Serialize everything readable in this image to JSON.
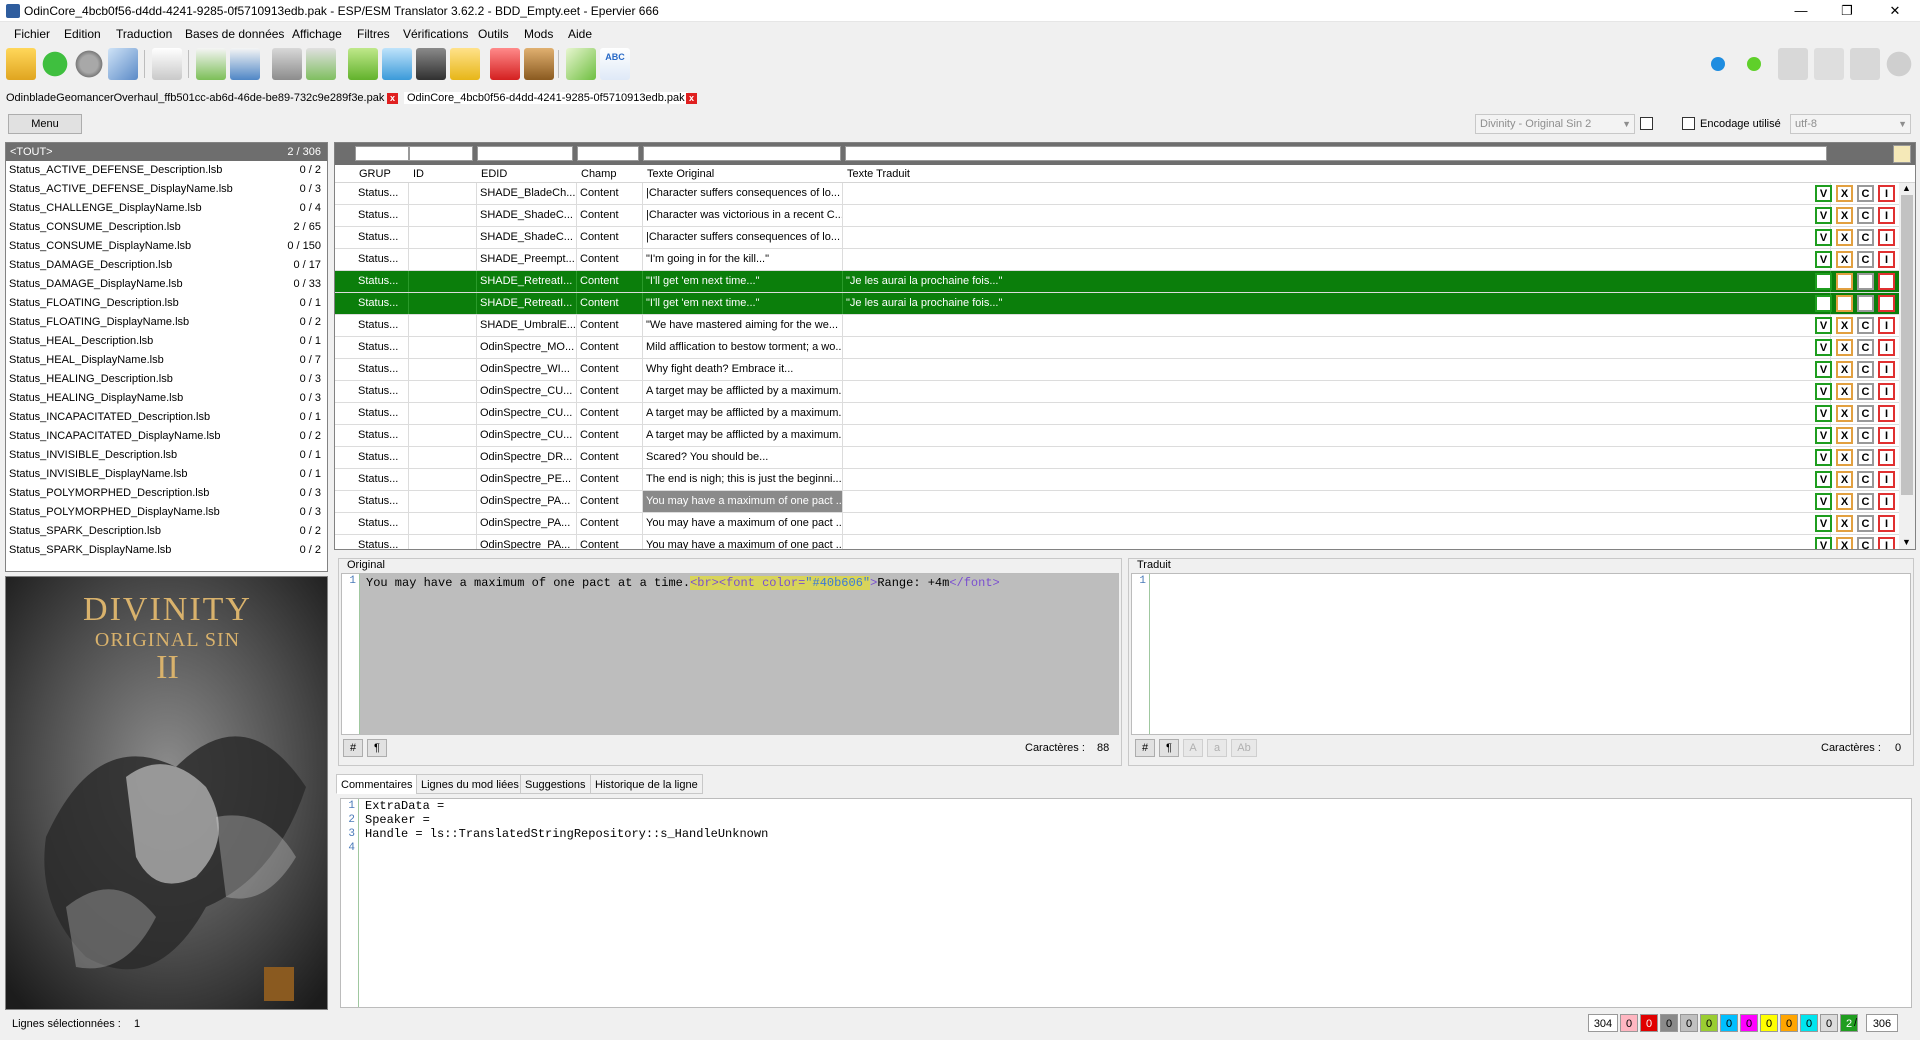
{
  "window": {
    "title": "OdinCore_4bcb0f56-d4dd-4241-9285-0f5710913edb.pak - ESP/ESM Translator 3.62.2 - BDD_Empty.eet - Epervier 666",
    "minimize": "—",
    "maximize": "❐",
    "close": "✕"
  },
  "menubar": [
    "Fichier",
    "Edition",
    "Traduction",
    "Bases de données",
    "Affichage",
    "Filtres",
    "Vérifications",
    "Outils",
    "Mods",
    "Aide"
  ],
  "file_tabs": [
    {
      "label": "OdinbladeGeomancerOverhaul_ffb501cc-ab6d-46de-be89-732c9e289f3e.pak",
      "close": "x"
    },
    {
      "label": "OdinCore_4bcb0f56-d4dd-4241-9285-0f5710913edb.pak",
      "close": "x"
    }
  ],
  "controls": {
    "menu_label": "Menu",
    "game_select": "Divinity - Original Sin 2",
    "encoding_label": "Encodage utilisé",
    "encoding_value": "utf-8"
  },
  "file_list": {
    "header_name": "<TOUT>",
    "header_count": "2 / 306",
    "items": [
      {
        "name": "Status_ACTIVE_DEFENSE_Description.lsb",
        "count": "0 / 2"
      },
      {
        "name": "Status_ACTIVE_DEFENSE_DisplayName.lsb",
        "count": "0 / 3"
      },
      {
        "name": "Status_CHALLENGE_DisplayName.lsb",
        "count": "0 / 4"
      },
      {
        "name": "Status_CONSUME_Description.lsb",
        "count": "2 / 65"
      },
      {
        "name": "Status_CONSUME_DisplayName.lsb",
        "count": "0 / 150"
      },
      {
        "name": "Status_DAMAGE_Description.lsb",
        "count": "0 / 17"
      },
      {
        "name": "Status_DAMAGE_DisplayName.lsb",
        "count": "0 / 33"
      },
      {
        "name": "Status_FLOATING_Description.lsb",
        "count": "0 / 1"
      },
      {
        "name": "Status_FLOATING_DisplayName.lsb",
        "count": "0 / 2"
      },
      {
        "name": "Status_HEAL_Description.lsb",
        "count": "0 / 1"
      },
      {
        "name": "Status_HEAL_DisplayName.lsb",
        "count": "0 / 7"
      },
      {
        "name": "Status_HEALING_Description.lsb",
        "count": "0 / 3"
      },
      {
        "name": "Status_HEALING_DisplayName.lsb",
        "count": "0 / 3"
      },
      {
        "name": "Status_INCAPACITATED_Description.lsb",
        "count": "0 / 1"
      },
      {
        "name": "Status_INCAPACITATED_DisplayName.lsb",
        "count": "0 / 2"
      },
      {
        "name": "Status_INVISIBLE_Description.lsb",
        "count": "0 / 1"
      },
      {
        "name": "Status_INVISIBLE_DisplayName.lsb",
        "count": "0 / 1"
      },
      {
        "name": "Status_POLYMORPHED_Description.lsb",
        "count": "0 / 3"
      },
      {
        "name": "Status_POLYMORPHED_DisplayName.lsb",
        "count": "0 / 3"
      },
      {
        "name": "Status_SPARK_Description.lsb",
        "count": "0 / 2"
      },
      {
        "name": "Status_SPARK_DisplayName.lsb",
        "count": "0 / 2"
      }
    ]
  },
  "cover": {
    "title_line1": "DIVINITY",
    "title_line2": "ORIGINAL SIN",
    "title_line3": "II"
  },
  "grid": {
    "columns": [
      "GRUP",
      "ID",
      "EDID",
      "Champ",
      "Texte Original",
      "Texte Traduit"
    ],
    "action_labels": [
      "V",
      "X",
      "C",
      "I"
    ],
    "rows": [
      {
        "grup": "Status...",
        "id": "",
        "edid": "SHADE_BladeCh...",
        "champ": "Content",
        "orig": "|Character suffers consequences of lo...",
        "trad": "",
        "sel": false,
        "hl": false
      },
      {
        "grup": "Status...",
        "id": "",
        "edid": "SHADE_ShadeC...",
        "champ": "Content",
        "orig": "|Character was victorious in a recent C...",
        "trad": "",
        "sel": false,
        "hl": false
      },
      {
        "grup": "Status...",
        "id": "",
        "edid": "SHADE_ShadeC...",
        "champ": "Content",
        "orig": "|Character suffers consequences of lo...",
        "trad": "",
        "sel": false,
        "hl": false
      },
      {
        "grup": "Status...",
        "id": "",
        "edid": "SHADE_Preempt...",
        "champ": "Content",
        "orig": "\"I'm going in for the kill...\"",
        "trad": "",
        "sel": false,
        "hl": false
      },
      {
        "grup": "Status...",
        "id": "",
        "edid": "SHADE_RetreatI...",
        "champ": "Content",
        "orig": "\"I'll get 'em next time...\"",
        "trad": "\"Je les aurai la prochaine fois...\"",
        "sel": true,
        "hl": false
      },
      {
        "grup": "Status...",
        "id": "",
        "edid": "SHADE_RetreatI...",
        "champ": "Content",
        "orig": "\"I'll get 'em next time...\"",
        "trad": "\"Je les aurai la prochaine fois...\"",
        "sel": true,
        "hl": false
      },
      {
        "grup": "Status...",
        "id": "",
        "edid": "SHADE_UmbralE...",
        "champ": "Content",
        "orig": "\"We have mastered aiming for the we...",
        "trad": "",
        "sel": false,
        "hl": false
      },
      {
        "grup": "Status...",
        "id": "",
        "edid": "OdinSpectre_MO...",
        "champ": "Content",
        "orig": "Mild afflication to bestow torment; a wo...",
        "trad": "",
        "sel": false,
        "hl": false
      },
      {
        "grup": "Status...",
        "id": "",
        "edid": "OdinSpectre_WI...",
        "champ": "Content",
        "orig": "Why fight death? Embrace it...",
        "trad": "",
        "sel": false,
        "hl": false
      },
      {
        "grup": "Status...",
        "id": "",
        "edid": "OdinSpectre_CU...",
        "champ": "Content",
        "orig": "A target may be afflicted by a maximum...",
        "trad": "",
        "sel": false,
        "hl": false
      },
      {
        "grup": "Status...",
        "id": "",
        "edid": "OdinSpectre_CU...",
        "champ": "Content",
        "orig": "A target may be afflicted by a maximum...",
        "trad": "",
        "sel": false,
        "hl": false
      },
      {
        "grup": "Status...",
        "id": "",
        "edid": "OdinSpectre_CU...",
        "champ": "Content",
        "orig": "A target may be afflicted by a maximum...",
        "trad": "",
        "sel": false,
        "hl": false
      },
      {
        "grup": "Status...",
        "id": "",
        "edid": "OdinSpectre_DR...",
        "champ": "Content",
        "orig": "Scared? You should be...",
        "trad": "",
        "sel": false,
        "hl": false
      },
      {
        "grup": "Status...",
        "id": "",
        "edid": "OdinSpectre_PE...",
        "champ": "Content",
        "orig": "The end is nigh; this is just the beginni...",
        "trad": "",
        "sel": false,
        "hl": false
      },
      {
        "grup": "Status...",
        "id": "",
        "edid": "OdinSpectre_PA...",
        "champ": "Content",
        "orig": "You may have a maximum of one pact ...",
        "trad": "",
        "sel": false,
        "hl": true
      },
      {
        "grup": "Status...",
        "id": "",
        "edid": "OdinSpectre_PA...",
        "champ": "Content",
        "orig": "You may have a maximum of one pact ...",
        "trad": "",
        "sel": false,
        "hl": false
      },
      {
        "grup": "Status...",
        "id": "",
        "edid": "OdinSpectre_PA...",
        "champ": "Content",
        "orig": "You may have a maximum of one pact ...",
        "trad": "",
        "sel": false,
        "hl": false
      }
    ]
  },
  "original_editor": {
    "label": "Original",
    "line_no": "1",
    "text_plain": "You may have a maximum of one pact at a time.",
    "tag_br": "<br>",
    "tag_font_open": "<font color=",
    "attr_value": "\"#40b606\"",
    "tag_close_bracket": ">",
    "text_range": "Range: +4m",
    "tag_font_close": "</font>",
    "chars_label": "Caractères :",
    "chars_value": "88",
    "btn_hash": "#",
    "btn_pilcrow": "¶"
  },
  "translated_editor": {
    "label": "Traduit",
    "line_no": "1",
    "chars_label": "Caractères :",
    "chars_value": "0",
    "btn_hash": "#",
    "btn_pilcrow": "¶",
    "btn_upper": "A",
    "btn_lower": "a",
    "btn_title": "Ab"
  },
  "bottom_tabs": [
    "Commentaires",
    "Lignes du mod liées",
    "Suggestions",
    "Historique de la ligne"
  ],
  "comments": {
    "line_numbers": [
      "1",
      "2",
      "3",
      "4"
    ],
    "lines": [
      "ExtraData =",
      "Speaker =",
      "Handle = ls::TranslatedStringRepository::s_HandleUnknown",
      ""
    ]
  },
  "status": {
    "selected_label": "Lignes sélectionnées :",
    "selected_value": "1",
    "counters": [
      {
        "value": "304",
        "color": "#ffffff"
      },
      {
        "value": "0",
        "color": "#ffb6c1"
      },
      {
        "value": "0",
        "color": "#e00000"
      },
      {
        "value": "0",
        "color": "#8a8a8a"
      },
      {
        "value": "0",
        "color": "#c0c0c0"
      },
      {
        "value": "0",
        "color": "#9acd32"
      },
      {
        "value": "0",
        "color": "#00bfff"
      },
      {
        "value": "0",
        "color": "#ff00ff"
      },
      {
        "value": "0",
        "color": "#ffff00"
      },
      {
        "value": "0",
        "color": "#ffa500"
      },
      {
        "value": "0",
        "color": "#00e5ee"
      },
      {
        "value": "0",
        "color": "#dcdcdc"
      },
      {
        "value": "2",
        "color": "#1f9d1f"
      }
    ],
    "separator": "/",
    "total": "306"
  }
}
